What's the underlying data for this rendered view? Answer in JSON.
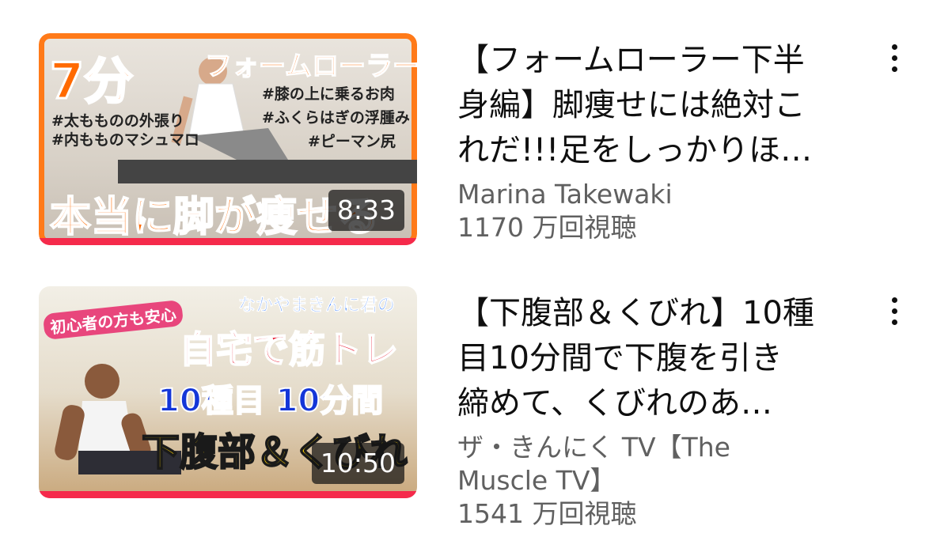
{
  "videos": [
    {
      "title": "【フォームローラー下半身編】脚痩せには絶対これだ!!!足をしっかりほ…",
      "title_lines": [
        "【フォームローラー下半",
        "身編】脚痩せには絶対こ",
        "れだ!!!足をしっかりほ…"
      ],
      "channel": "Marina Takewaki",
      "views": "1170 万回視聴",
      "duration": "8:33",
      "progress_fraction": 1.0,
      "thumbnail": {
        "headline": "7分",
        "subheadline": "フォームローラーで",
        "tags_left": [
          "#太もものの外張り",
          "#内もものマシュマロ"
        ],
        "tags_right": [
          "#膝の上に乗るお肉",
          "#ふくらはぎの浮腫み",
          "#ピーマン尻"
        ],
        "bottom_text": "本当に脚が痩せる",
        "accent_color": "#ff6a00"
      }
    },
    {
      "title": "【下腹部＆くびれ】10種目10分間で下腹を引き締めて、くびれのあ…",
      "title_lines": [
        "【下腹部＆くびれ】10種",
        "目10分間で下腹を引き",
        "締めて、くびれのあ…"
      ],
      "channel": "ザ・きんにくTV【The Muscle TV】",
      "channel_lines": [
        "ザ・きんにく TV【The",
        "Muscle TV】"
      ],
      "views": "1541 万回視聴",
      "duration": "10:50",
      "progress_fraction": 1.0,
      "thumbnail": {
        "badge": "初心者の方も安心",
        "top_text": "なかやまきんに君の",
        "line1": "自宅で筋トレ",
        "line2": "10種目 10分間",
        "line3": "下腹部＆くびれ",
        "accent_color": "#e8182f"
      }
    }
  ],
  "colors": {
    "progress": "#f52a4b",
    "meta_text": "#606060",
    "title_text": "#0f0f0f"
  },
  "icons": {
    "menu": "more-vert-icon"
  }
}
